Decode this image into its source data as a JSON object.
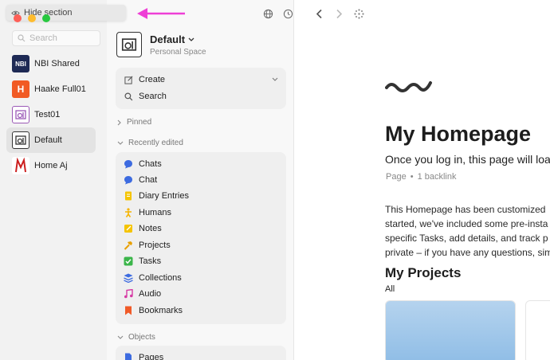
{
  "tooltip": {
    "label": "Hide section"
  },
  "spaces_rail": {
    "search_placeholder": "Search",
    "items": [
      {
        "label": "NBI Shared",
        "icon": "nbi-logo-icon",
        "badge": "NBI",
        "color": "#1e2a55"
      },
      {
        "label": "Haake Full01",
        "icon": "letter-h-icon",
        "badge": "H",
        "color": "#f15a24"
      },
      {
        "label": "Test01",
        "icon": "test01-logo-icon"
      },
      {
        "label": "Default",
        "icon": "default-space-icon"
      },
      {
        "label": "Home Aj",
        "icon": "home-aj-logo-icon",
        "color": "#cc1f1f"
      }
    ]
  },
  "sidebar": {
    "space_name": "Default",
    "space_subtitle": "Personal Space",
    "actions": [
      {
        "label": "Create",
        "icon": "edit-icon"
      },
      {
        "label": "Search",
        "icon": "search-icon"
      }
    ],
    "sections": {
      "pinned": "Pinned",
      "recent": "Recently edited",
      "objects": "Objects"
    },
    "recent_items": [
      {
        "label": "Chats",
        "icon": "chat-bubble-icon",
        "color": "#3d6be0"
      },
      {
        "label": "Chat",
        "icon": "chat-bubble-icon",
        "color": "#3d6be0"
      },
      {
        "label": "Diary Entries",
        "icon": "notebook-icon",
        "color": "#f5c400"
      },
      {
        "label": "Humans",
        "icon": "person-icon",
        "color": "#f5b400"
      },
      {
        "label": "Notes",
        "icon": "note-icon",
        "color": "#f5c400"
      },
      {
        "label": "Projects",
        "icon": "hammer-icon",
        "color": "#e8a000"
      },
      {
        "label": "Tasks",
        "icon": "checkbox-icon",
        "color": "#3bb54a"
      },
      {
        "label": "Collections",
        "icon": "layers-icon",
        "color": "#3d6be0"
      },
      {
        "label": "Audio",
        "icon": "music-note-icon",
        "color": "#d63aa4"
      },
      {
        "label": "Bookmarks",
        "icon": "bookmark-icon",
        "color": "#f05a28"
      }
    ],
    "object_items": [
      {
        "label": "Pages",
        "icon": "page-icon",
        "color": "#3d6be0"
      }
    ]
  },
  "main": {
    "title": "My Homepage",
    "subtitle": "Once you log in, this page will load",
    "meta_type": "Page",
    "meta_sep": "•",
    "meta_backlinks": "1 backlink",
    "paragraph_lines": [
      "This Homepage has been customized",
      "started, we've included some pre-insta",
      "specific Tasks, add details, and track p",
      "private – if you have any questions, sim"
    ],
    "projects_heading": "My Projects",
    "filter_label": "All"
  },
  "colors": {
    "rail_bg": "#f2f2f2",
    "sidebar_bg": "#f8f8f8",
    "card_bg": "#efefef",
    "arrow": "#ee3fd6"
  }
}
